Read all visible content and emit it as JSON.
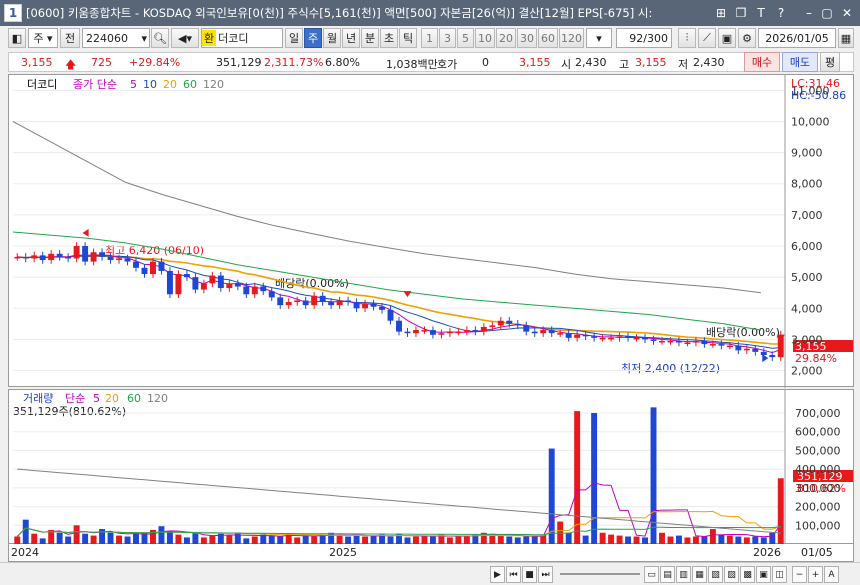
{
  "window": {
    "tab_number": "1",
    "title": "[0600] 키움종합차트 - KOSDAQ 외국인보유[0(천)] 주식수[5,161(천)] 액면[500] 자본금[26(억)] 결산[12월] EPS[-675] 시:"
  },
  "toolbar": {
    "market": "주",
    "scope": "전",
    "code": "224060",
    "exchange_badge": "환",
    "stock_name": "더코디",
    "periods": [
      "일",
      "주",
      "월",
      "년",
      "분",
      "초",
      "틱"
    ],
    "selected_period": "주",
    "intervals": [
      "1",
      "3",
      "5",
      "10",
      "20",
      "30",
      "60",
      "120"
    ],
    "count": "92",
    "count_max": "/300",
    "date": "2026/01/05"
  },
  "quote": {
    "price": "3,155",
    "change": "725",
    "change_pct": "+29.84%",
    "volume": "351,129",
    "volume_ratio": "2,311.73%",
    "turnover": "6.80%",
    "amount": "1,038백만",
    "hoga_label": "호가",
    "hoga_value": "0",
    "hoga_price": "3,155",
    "open_label": "시",
    "open": "2,430",
    "high_label": "고",
    "high": "3,155",
    "low_label": "저",
    "low": "2,430",
    "buy_label": "매수",
    "sell_label": "매도",
    "eval_label": "평"
  },
  "price_pane": {
    "legend_name": "더코디",
    "legend_ma": [
      "종가 단순",
      "5",
      "10",
      "20",
      "60",
      "120"
    ],
    "lc": "LC:31.46",
    "hc": "HC:-50.86",
    "y_labels": [
      "11,000",
      "10,000",
      "9,000",
      "8,000",
      "7,000",
      "6,000",
      "5,000",
      "4,000",
      "3,000",
      "2,000"
    ],
    "last_price_badge": "3,155",
    "last_pct_badge": "29.84%",
    "high_annotation": "최고 6,420 (06/10)",
    "low_annotation": "최저 2,400 (12/22)",
    "dividend_1": "배당락(0.00%)",
    "dividend_2": "배당락(0.00%)"
  },
  "volume_pane": {
    "legend_name": "거래량",
    "legend_ma": [
      "단순",
      "5",
      "20",
      "60",
      "120"
    ],
    "current_vol": "351,129주(810.62%)",
    "y_labels": [
      "700,000",
      "600,000",
      "500,000",
      "400,000",
      "300,000",
      "200,000",
      "100,000"
    ],
    "vol_badge": "351,129",
    "vol_pct_badge": "810.62%"
  },
  "x_axis": {
    "labels": [
      "2024",
      "2025",
      "2026",
      "01/05"
    ]
  },
  "colors": {
    "up": "#e8191c",
    "down": "#1f47d6",
    "ma5": "#c200c2",
    "ma10": "#1b4fb3",
    "ma20": "#f0a000",
    "ma60": "#22a64b",
    "ma120": "#808080"
  },
  "chart_data": {
    "type": "candlestick",
    "x_range": [
      "2024",
      "2026/01/05"
    ],
    "price_ylim": [
      1600,
      11300
    ],
    "volume_ylim": [
      0,
      780000
    ],
    "weekly_close": [
      5650,
      5600,
      5700,
      5550,
      5750,
      5650,
      5600,
      6000,
      5500,
      5800,
      5650,
      5550,
      5600,
      5500,
      5300,
      5100,
      5500,
      5200,
      4450,
      5100,
      5000,
      4600,
      4800,
      5050,
      4650,
      4800,
      4700,
      4450,
      4700,
      4550,
      4350,
      4100,
      4200,
      4250,
      4100,
      4400,
      4200,
      4100,
      4250,
      4200,
      4000,
      4150,
      4050,
      3950,
      3600,
      3250,
      3200,
      3300,
      3300,
      3150,
      3200,
      3250,
      3250,
      3300,
      3250,
      3400,
      3450,
      3600,
      3500,
      3450,
      3250,
      3200,
      3300,
      3200,
      3200,
      3050,
      3150,
      3100,
      3050,
      3050,
      3050,
      3100,
      3050,
      3050,
      3000,
      2950,
      2950,
      2950,
      2900,
      2900,
      2950,
      2850,
      2850,
      2800,
      2800,
      2650,
      2700,
      2600,
      2500,
      2430,
      3155
    ],
    "ma120": [
      10000,
      9350,
      8700,
      8050,
      7650,
      7300,
      6950,
      6650,
      6400,
      6150,
      5950,
      5750,
      5600,
      5450,
      5300,
      5100,
      4950,
      4850,
      4750,
      4650,
      4500
    ],
    "ma60": [
      6450,
      6350,
      6250,
      6100,
      5900,
      5650,
      5400,
      5200,
      5000,
      4800,
      4600,
      4450,
      4300,
      4200,
      4100,
      4000,
      3900,
      3800,
      3650,
      3500,
      3300
    ],
    "annotations": {
      "max": 6420,
      "max_date": "06/10",
      "min": 2400,
      "min_date": "12/22"
    },
    "weekly_volume": [
      40000,
      130000,
      55000,
      30000,
      75000,
      60000,
      40000,
      100000,
      55000,
      45000,
      80000,
      60000,
      45000,
      40000,
      55000,
      60000,
      75000,
      95000,
      65000,
      50000,
      35000,
      60000,
      35000,
      45000,
      55000,
      45000,
      60000,
      30000,
      40000,
      50000,
      45000,
      40000,
      55000,
      35000,
      45000,
      40000,
      50000,
      60000,
      45000,
      40000,
      45000,
      40000,
      45000,
      50000,
      40000,
      55000,
      35000,
      40000,
      45000,
      40000,
      50000,
      35000,
      45000,
      40000,
      50000,
      60000,
      55000,
      45000,
      40000,
      35000,
      40000,
      45000,
      50000,
      510000,
      120000,
      60000,
      710000,
      45000,
      700000,
      60000,
      50000,
      45000,
      40000,
      40000,
      35000,
      730000,
      60000,
      40000,
      45000,
      35000,
      40000,
      40000,
      80000,
      50000,
      45000,
      40000,
      35000,
      40000,
      35000,
      60000,
      351129
    ]
  }
}
